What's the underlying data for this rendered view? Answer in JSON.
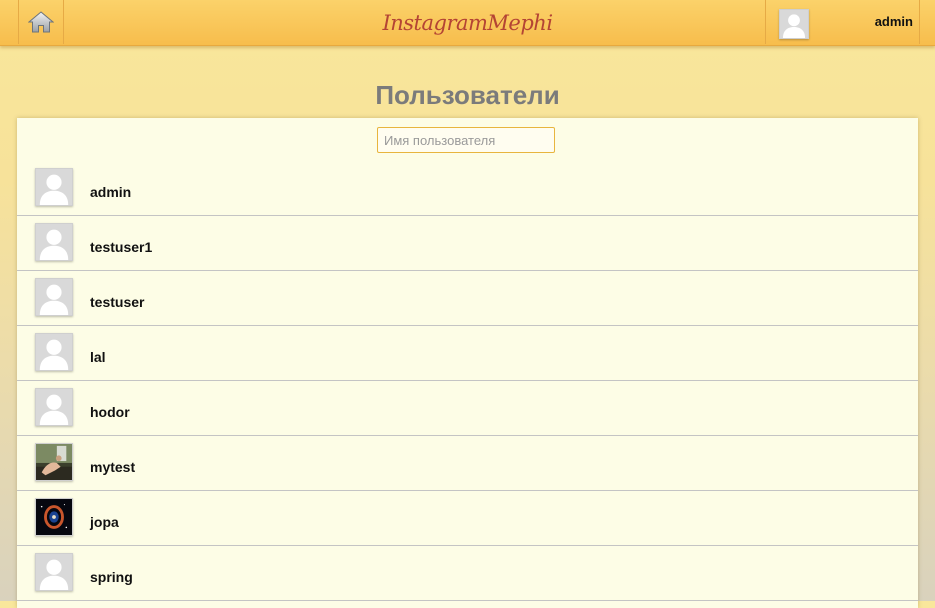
{
  "header": {
    "brand": "InstagramMephi",
    "home_icon": "home-icon",
    "current_user": "admin",
    "colors": {
      "bar_top": "#fbd26a",
      "bar_bottom": "#f7bd4c",
      "brand": "#b44434"
    }
  },
  "page": {
    "title": "Пользователи"
  },
  "search": {
    "placeholder": "Имя пользователя",
    "value": ""
  },
  "users": [
    {
      "name": "admin",
      "avatar": "default-avatar-icon"
    },
    {
      "name": "testuser1",
      "avatar": "default-avatar-icon"
    },
    {
      "name": "testuser",
      "avatar": "default-avatar-icon"
    },
    {
      "name": "lal",
      "avatar": "default-avatar-icon"
    },
    {
      "name": "hodor",
      "avatar": "default-avatar-icon"
    },
    {
      "name": "mytest",
      "avatar": "photo-avatar-hand"
    },
    {
      "name": "jopa",
      "avatar": "photo-avatar-nebula"
    },
    {
      "name": "spring",
      "avatar": "default-avatar-icon"
    }
  ]
}
